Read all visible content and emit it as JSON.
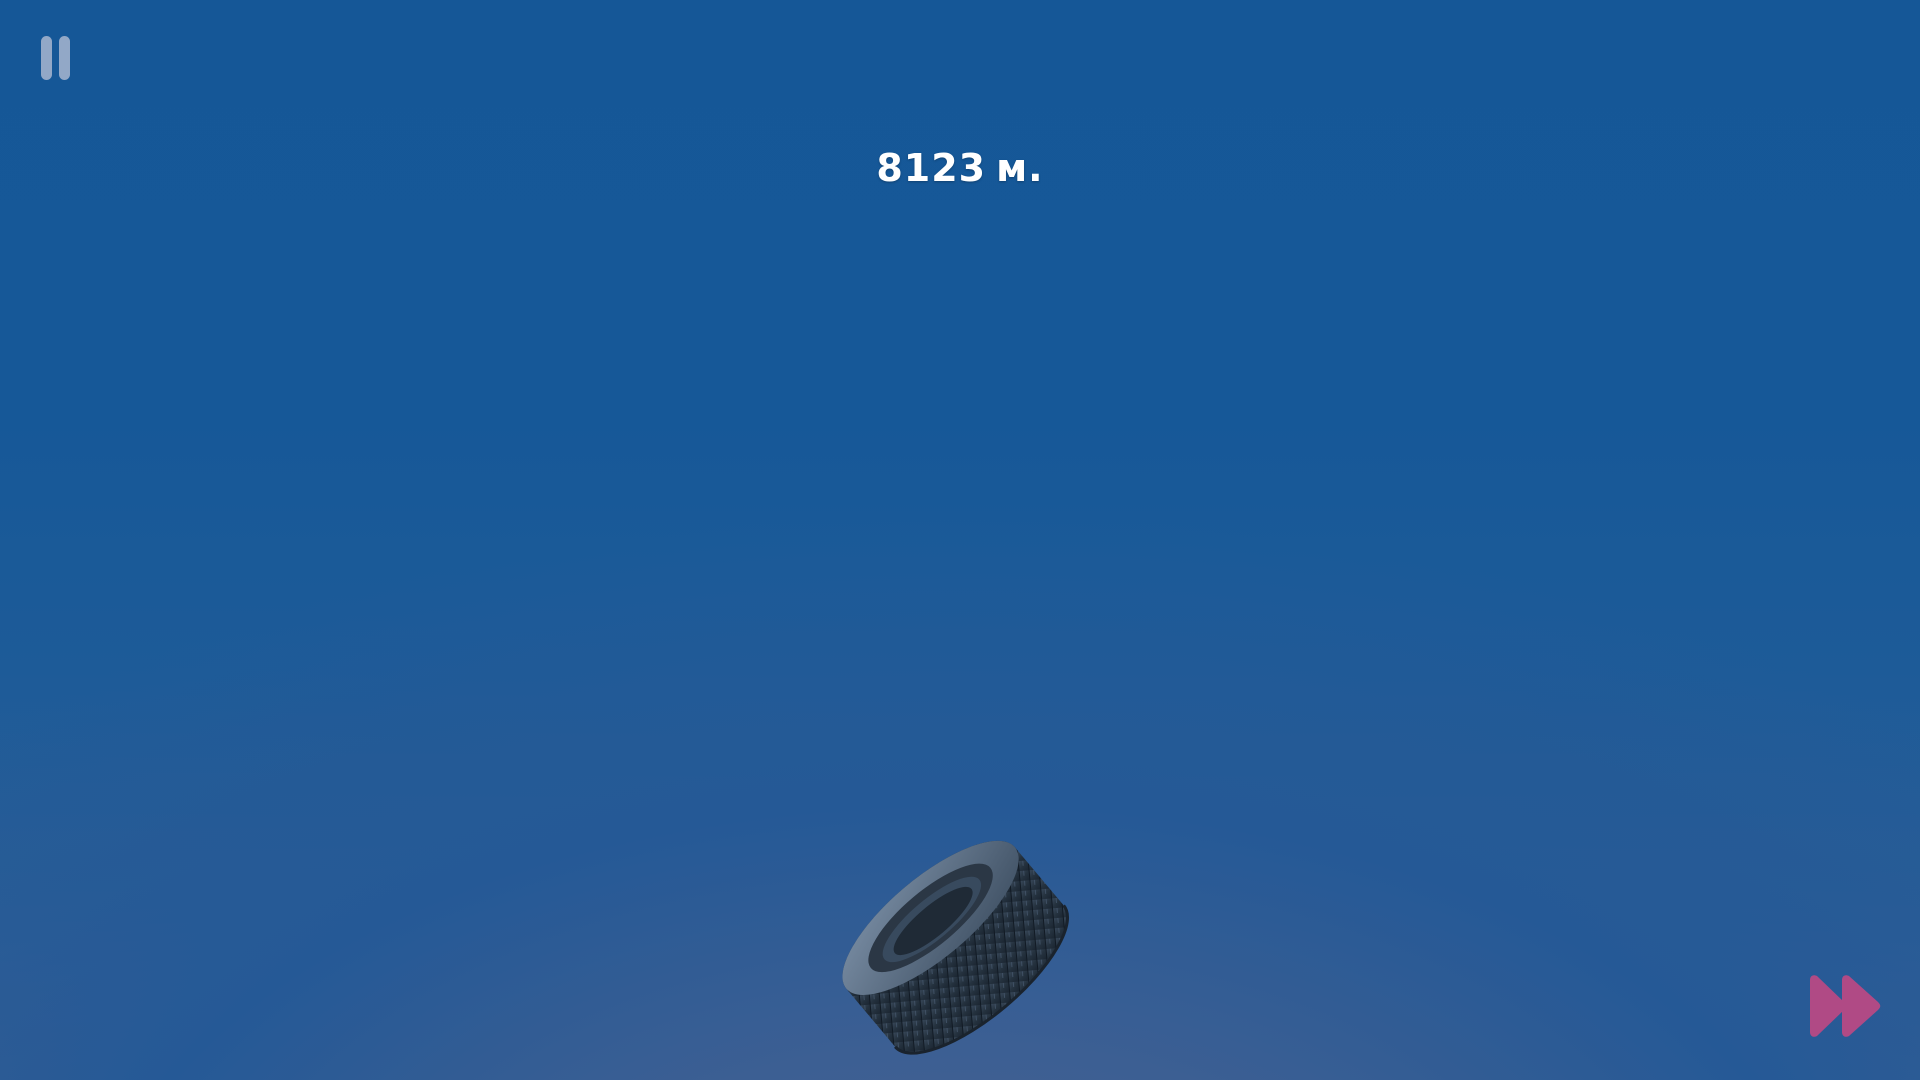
{
  "hud": {
    "distance_value": "8123",
    "distance_unit": "м."
  },
  "icons": {
    "pause": "pause-icon",
    "fast_forward": "fast-forward-icon",
    "player_object": "tire"
  },
  "colors": {
    "sky_top": "#155797",
    "sky_bottom": "#48608f",
    "pause_icon": "#a8b6cf",
    "fast_forward_icon": "#b04a85",
    "distance_text": "#ffffff"
  }
}
